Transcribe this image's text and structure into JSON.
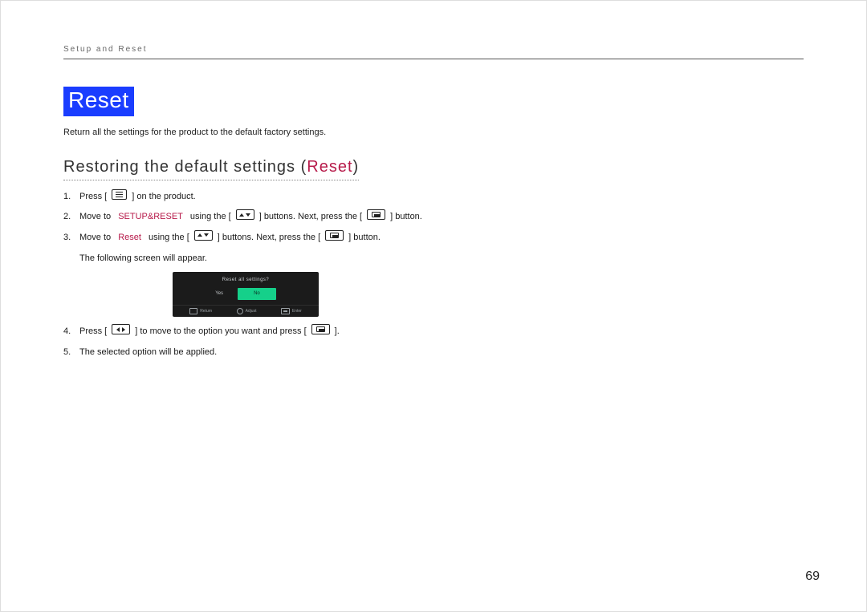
{
  "header": {
    "breadcrumb": "Setup and Reset"
  },
  "title": "Reset",
  "intro": "Return all the settings for the product to the default factory settings.",
  "subhead": {
    "prefix": "Restoring the default settings (",
    "accent": "Reset",
    "suffix": ")"
  },
  "steps": {
    "s1": {
      "num": "1.",
      "a": "Press [",
      "b": "] on the product."
    },
    "s2": {
      "num": "2.",
      "a": "Move to ",
      "accent": "SETUP&RESET",
      "b": " using the [",
      "c": "] buttons. Next, press the [",
      "d": "] button."
    },
    "s3": {
      "num": "3.",
      "a": "Move to ",
      "accent": "Reset",
      "b": " using the [",
      "c": "] buttons. Next, press the [",
      "d": "] button.",
      "note": "The following screen will appear."
    },
    "s4": {
      "num": "4.",
      "a": "Press [",
      "b": "] to move to the option you want and press [",
      "c": "]."
    },
    "s5": {
      "num": "5.",
      "a": "The selected option will be applied."
    }
  },
  "osd": {
    "question": "Reset all settings?",
    "yes": "Yes",
    "no": "No",
    "foot_return": "Return",
    "foot_adjust": "Adjust",
    "foot_enter": "Enter"
  },
  "page_number": "69"
}
